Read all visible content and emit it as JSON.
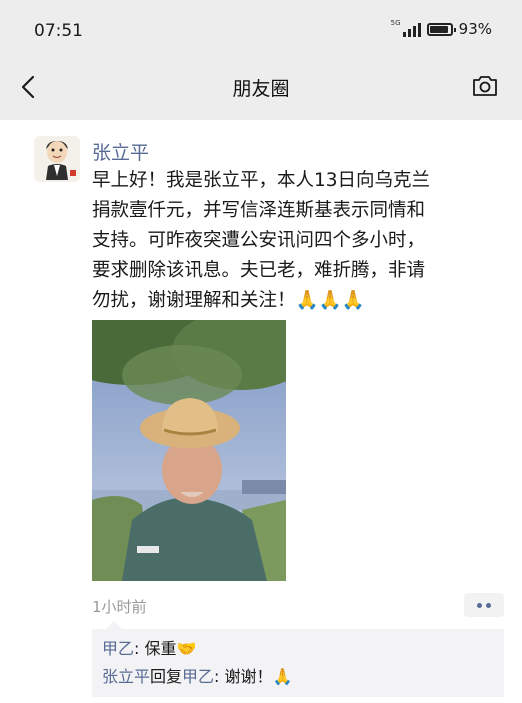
{
  "status_bar": {
    "time": "07:51",
    "network": "5G",
    "battery": "93%",
    "battery_level": 0.93
  },
  "nav": {
    "title": "朋友圈",
    "back_icon": "chevron-left-icon",
    "camera_icon": "camera-icon"
  },
  "post": {
    "author": "张立平",
    "content_lines": [
      "早上好！我是张立平，本人13日向乌克兰",
      "捐款壹仟元，并写信泽连斯基表示同情和",
      "支持。可昨夜突遭公安讯问四个多小时，",
      "要求删除该讯息。夫已老，难折腾，非请",
      "勿扰，谢谢理解和关注！🙏🙏🙏"
    ],
    "timestamp": "1小时前"
  },
  "comments": [
    {
      "name": "甲乙",
      "separator": ": ",
      "text": "保重🤝"
    },
    {
      "name": "张立平",
      "reply_word": "回复",
      "target": "甲乙",
      "separator": ": ",
      "text": "谢谢！🙏"
    }
  ],
  "colors": {
    "link_blue": "#576b95",
    "header_bg": "#ededed",
    "comment_bg": "#f3f3f5"
  }
}
